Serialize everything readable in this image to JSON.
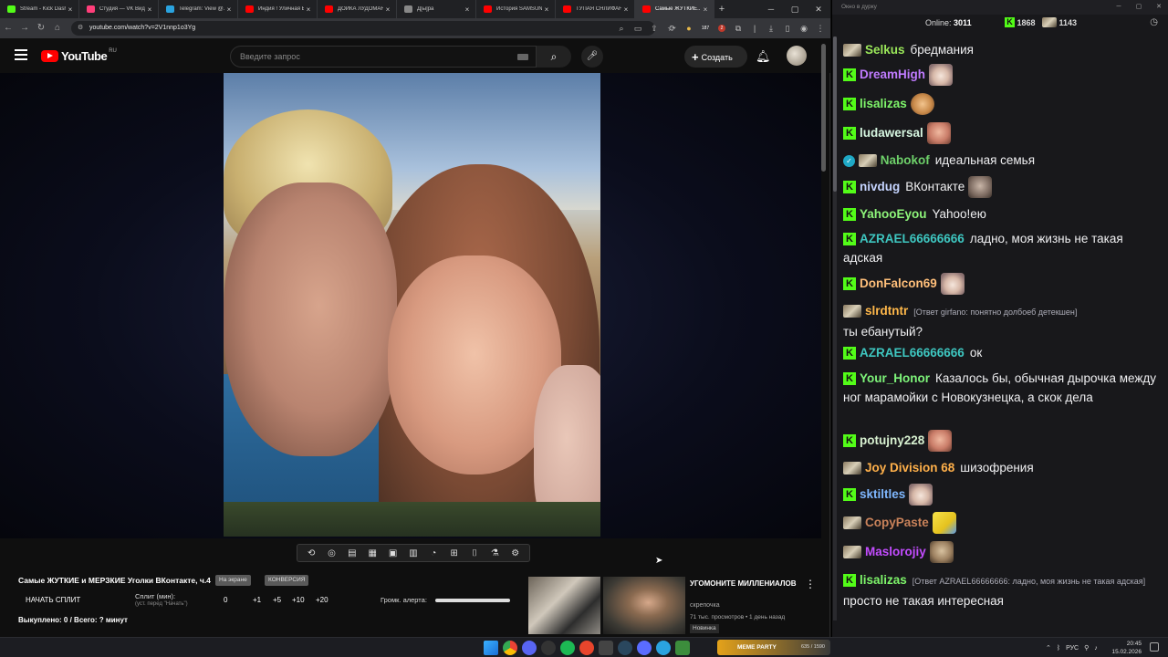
{
  "browser": {
    "tabs": [
      {
        "label": "Stream - Kick Dash",
        "color": "#53fc18"
      },
      {
        "label": "Студия — VK Видео",
        "color": "#ff3e7a"
      },
      {
        "label": "Telegram: View @...",
        "color": "#2aa3df"
      },
      {
        "label": "Индия ! Уличная Е...",
        "color": "#ff0000"
      },
      {
        "label": "ДОЙКА ЛУДОМАН...",
        "color": "#ff0000"
      },
      {
        "label": "Д[ы]ра",
        "color": "#888888"
      },
      {
        "label": "История SAMSUN...",
        "color": "#ff0000"
      },
      {
        "label": "ТУПАЯ СНЛИФАН...",
        "color": "#ff0000"
      },
      {
        "label": "Самые ЖУТКИЕ...",
        "color": "#ff0000"
      }
    ],
    "new_tab": "+",
    "url": "youtube.com/watch?v=2V1nnp1o3Yg",
    "ext_badge_1": "187",
    "ext_badge_2": "2"
  },
  "youtube": {
    "logo_text": "YouTube",
    "region": "RU",
    "search_placeholder": "Введите запрос",
    "create_label": "Создать",
    "video_title": "Самые ЖУТКИЕ и МЕРЗКИЕ Уголки ВКонтакте, ч.4",
    "pill_1": "На экране",
    "pill_2": "КОНВЕРСИЯ",
    "start_split": "НАЧАТЬ СПЛИТ",
    "split_label": "Сплит (мин):",
    "split_sub": "(уст. перед \"Начать\")",
    "split_values": [
      "0",
      "+1",
      "+5",
      "+10",
      "+20"
    ],
    "alert_label": "Громк. алерта:",
    "alert_volume": 1.0,
    "bought": "Выкуплено: 0 / Всего: ? минут",
    "rec": {
      "title": "УГОМОНИТЕ МИЛЛЕНИАЛОВ",
      "channel": "скрепочка",
      "meta": "71 тыс. просмотров • 1 день назад",
      "badge": "Новинка"
    }
  },
  "chat": {
    "window_title": "Окно в дурку",
    "online_label": "Online:",
    "online_count": "3011",
    "count_1": "1868",
    "count_2": "1143",
    "messages": [
      {
        "user": "Selkus",
        "color": "#9be85a",
        "badge": "img",
        "text": "бредмания"
      },
      {
        "user": "DreamHigh",
        "color": "#c07bff",
        "badge": "k",
        "text": "",
        "emote": "cat"
      },
      {
        "user": "lisalizas",
        "color": "#7ef56a",
        "badge": "k",
        "text": "",
        "emote": "burger"
      },
      {
        "user": "ludawersal",
        "color": "#d5f5e0",
        "badge": "k",
        "text": "",
        "emote": "face"
      },
      {
        "user": "Nabokof",
        "color": "#6ed16a",
        "badge": "check",
        "text": "идеальная семья"
      },
      {
        "user": "nivdug",
        "color": "#c5d4ff",
        "badge": "k",
        "text": "ВКонтакте",
        "emote": "man"
      },
      {
        "user": "YahooEyou",
        "color": "#8ef57a",
        "badge": "k",
        "text": "Yahoo!ею"
      },
      {
        "user": "AZRAEL66666666",
        "color": "#3ec6c0",
        "badge": "k",
        "text": "ладно, моя жизнь не такая адская"
      },
      {
        "user": "DonFalcon69",
        "color": "#ffbf7a",
        "badge": "k",
        "text": "",
        "emote": "cat"
      },
      {
        "user": "slrdtntr",
        "color": "#ffb84a",
        "badge": "img",
        "reply": "[Ответ girfano: понятно долбоеб детекшен]",
        "text": "ты ебанутый?"
      },
      {
        "user": "AZRAEL66666666",
        "color": "#3ec6c0",
        "badge": "k",
        "text": "ок"
      },
      {
        "user": "Your_Honor",
        "color": "#7ef57a",
        "badge": "k",
        "text": "Казалось бы, обычная дырочка между ног марамойки с Новокузнецка, а скок дела"
      },
      {
        "user": "potujny228",
        "color": "#d7f0d0",
        "badge": "k",
        "text": "",
        "emote": "face"
      },
      {
        "user": "Joy Division 68",
        "color": "#ffb04a",
        "badge": "img",
        "text": "шизофрения"
      },
      {
        "user": "sktiltles",
        "color": "#7fb7ff",
        "badge": "k",
        "text": "",
        "emote": "cat"
      },
      {
        "user": "CopyPaste",
        "color": "#c9825a",
        "badge": "img",
        "text": "",
        "emote": "sponge"
      },
      {
        "user": "Maslorojiy",
        "color": "#c34cff",
        "badge": "img",
        "text": "",
        "emote": "man2"
      },
      {
        "user": "lisalizas",
        "color": "#7ef56a",
        "badge": "k",
        "reply": "[Ответ AZRAEL66666666: ладно, моя жизнь не такая адская]",
        "text": "просто не такая интересная"
      }
    ]
  },
  "taskbar": {
    "meme_party": "MEME PARTY",
    "meme_count": "635 / 1590",
    "lang": "РУС",
    "time": "20:45",
    "date": "15.02.2026"
  }
}
